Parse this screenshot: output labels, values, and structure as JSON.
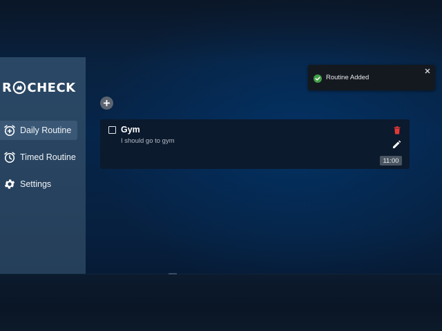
{
  "app": {
    "logo_prefix": "R",
    "logo_suffix": "CHECK",
    "logo_mark_icon": "hand-circle-logo"
  },
  "sidebar": {
    "items": [
      {
        "label": "Daily Routine",
        "icon": "alarm-add-icon",
        "active": true
      },
      {
        "label": "Timed Routine",
        "icon": "alarm-clock-icon",
        "active": false
      },
      {
        "label": "Settings",
        "icon": "gear-icon",
        "active": false
      }
    ]
  },
  "main": {
    "add_button_icon": "plus-icon",
    "routines": [
      {
        "title": "Gym",
        "description": "I should go to gym",
        "time": "11:00",
        "checked": false
      }
    ]
  },
  "toast": {
    "message": "Routine Added",
    "status_icon": "check-circle-icon",
    "close_icon": "close-icon"
  },
  "colors": {
    "accent_delete": "#e53935",
    "toast_success": "#43a047",
    "sidebar_bg": "#2a4866",
    "sidebar_active": "#3a5876",
    "card_bg": "#0c1a2e"
  }
}
